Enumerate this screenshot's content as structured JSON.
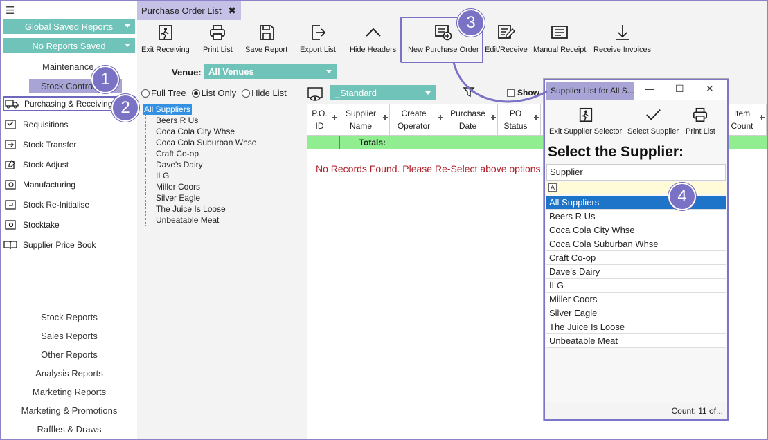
{
  "sidebar": {
    "global_saved_reports": "Global Saved Reports",
    "no_reports_saved": "No Reports Saved",
    "maintenance": "Maintenance",
    "stock_control": "Stock Control",
    "items": [
      {
        "label": "Purchasing & Receiving",
        "icon": "truck-icon"
      },
      {
        "label": "Requisitions",
        "icon": "requisition-icon"
      },
      {
        "label": "Stock Transfer",
        "icon": "transfer-icon"
      },
      {
        "label": "Stock Adjust",
        "icon": "adjust-icon"
      },
      {
        "label": "Manufacturing",
        "icon": "manufacturing-icon"
      },
      {
        "label": "Stock Re-Initialise",
        "icon": "reinitialise-icon"
      },
      {
        "label": "Stocktake",
        "icon": "stocktake-icon"
      },
      {
        "label": "Supplier Price Book",
        "icon": "book-icon"
      }
    ],
    "reports": [
      "Stock Reports",
      "Sales Reports",
      "Other Reports",
      "Analysis Reports",
      "Marketing Reports",
      "Marketing & Promotions",
      "Raffles & Draws"
    ]
  },
  "tab": {
    "title": "Purchase Order List",
    "close": "✖"
  },
  "toolbar": [
    {
      "label": "Exit Receiving",
      "icon": "exit-runner-icon"
    },
    {
      "label": "Print List",
      "icon": "printer-icon"
    },
    {
      "label": "Save Report",
      "icon": "floppy-icon"
    },
    {
      "label": "Export List",
      "icon": "export-icon"
    },
    {
      "label": "Hide Headers",
      "icon": "chevron-up-icon"
    },
    {
      "label": "New Purchase Order",
      "icon": "new-order-icon"
    },
    {
      "label": "Edit/Receive",
      "icon": "edit-icon"
    },
    {
      "label": "Manual Receipt",
      "icon": "receipt-icon"
    },
    {
      "label": "Receive Invoices",
      "icon": "download-icon"
    }
  ],
  "venue": {
    "label": "Venue:",
    "value": "All Venues"
  },
  "view_options": {
    "full_tree": "Full Tree",
    "list_only": "List Only",
    "hide_list": "Hide List",
    "selected": "List Only"
  },
  "tree": [
    "All Suppliers",
    "Beers R Us",
    "Coca Cola City Whse",
    "Coca Cola Suburban Whse",
    "Craft Co-op",
    "Dave's Dairy",
    "ILG",
    "Miller Coors",
    "Silver Eagle",
    "The Juice Is Loose",
    "Unbeatable Meat"
  ],
  "layout": {
    "value": "_Standard",
    "show_label": "Show"
  },
  "grid": {
    "columns": [
      "P.O. ID",
      "Supplier Name",
      "Create Operator",
      "Purchase Date",
      "PO Status",
      "Item Count"
    ],
    "totals_label": "Totals:",
    "empty_message": "No Records Found. Please Re-Select above options"
  },
  "popup": {
    "title": "Supplier List for All S...",
    "tools": [
      {
        "label": "Exit Supplier Selector",
        "icon": "exit-runner-icon"
      },
      {
        "label": "Select Supplier",
        "icon": "checkmark-icon"
      },
      {
        "label": "Print List",
        "icon": "printer-icon"
      }
    ],
    "heading": "Select the Supplier:",
    "column": "Supplier",
    "items": [
      "All Suppliers",
      "Beers R Us",
      "Coca Cola City Whse",
      "Coca Cola Suburban Whse",
      "Craft Co-op",
      "Dave's Dairy",
      "ILG",
      "Miller Coors",
      "Silver Eagle",
      "The Juice Is Loose",
      "Unbeatable Meat"
    ],
    "selected": "All Suppliers",
    "count": "Count:  11  of..."
  },
  "callouts": [
    "1",
    "2",
    "3",
    "4"
  ],
  "colors": {
    "teal": "#6fc3b8",
    "purple": "#7a72c4",
    "lavender": "#a9a4d6",
    "selection": "#1e74c9",
    "totals": "#90ee90",
    "error": "#b0202a"
  }
}
